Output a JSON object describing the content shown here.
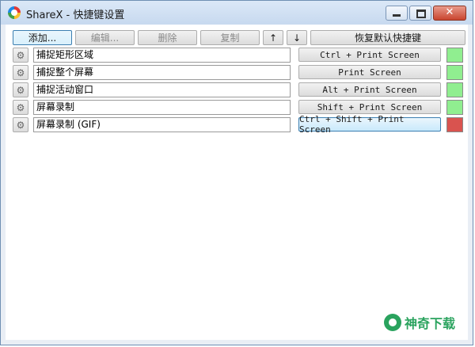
{
  "window": {
    "title": "ShareX - 快捷键设置",
    "close_glyph": "✕"
  },
  "toolbar": {
    "add": "添加...",
    "edit": "编辑...",
    "remove": "删除",
    "duplicate": "复制",
    "up": "↑",
    "down": "↓",
    "reset": "恢复默认快捷键"
  },
  "hotkeys": [
    {
      "name": "捕捉矩形区域",
      "key": "Ctrl + Print Screen",
      "status_color": "#90ee90"
    },
    {
      "name": "捕捉整个屏幕",
      "key": "Print Screen",
      "status_color": "#90ee90"
    },
    {
      "name": "捕捉活动窗口",
      "key": "Alt + Print Screen",
      "status_color": "#90ee90"
    },
    {
      "name": "屏幕录制",
      "key": "Shift + Print Screen",
      "status_color": "#90ee90"
    },
    {
      "name": "屏幕录制 (GIF)",
      "key": "Ctrl + Shift + Print Screen",
      "status_color": "#d9534f"
    }
  ],
  "icons": {
    "settings": "gear-icon",
    "app": "sharex-icon",
    "minimize": "minimize-icon",
    "maximize": "maximize-icon",
    "close": "close-icon"
  },
  "watermark": {
    "text": "神奇下载"
  }
}
